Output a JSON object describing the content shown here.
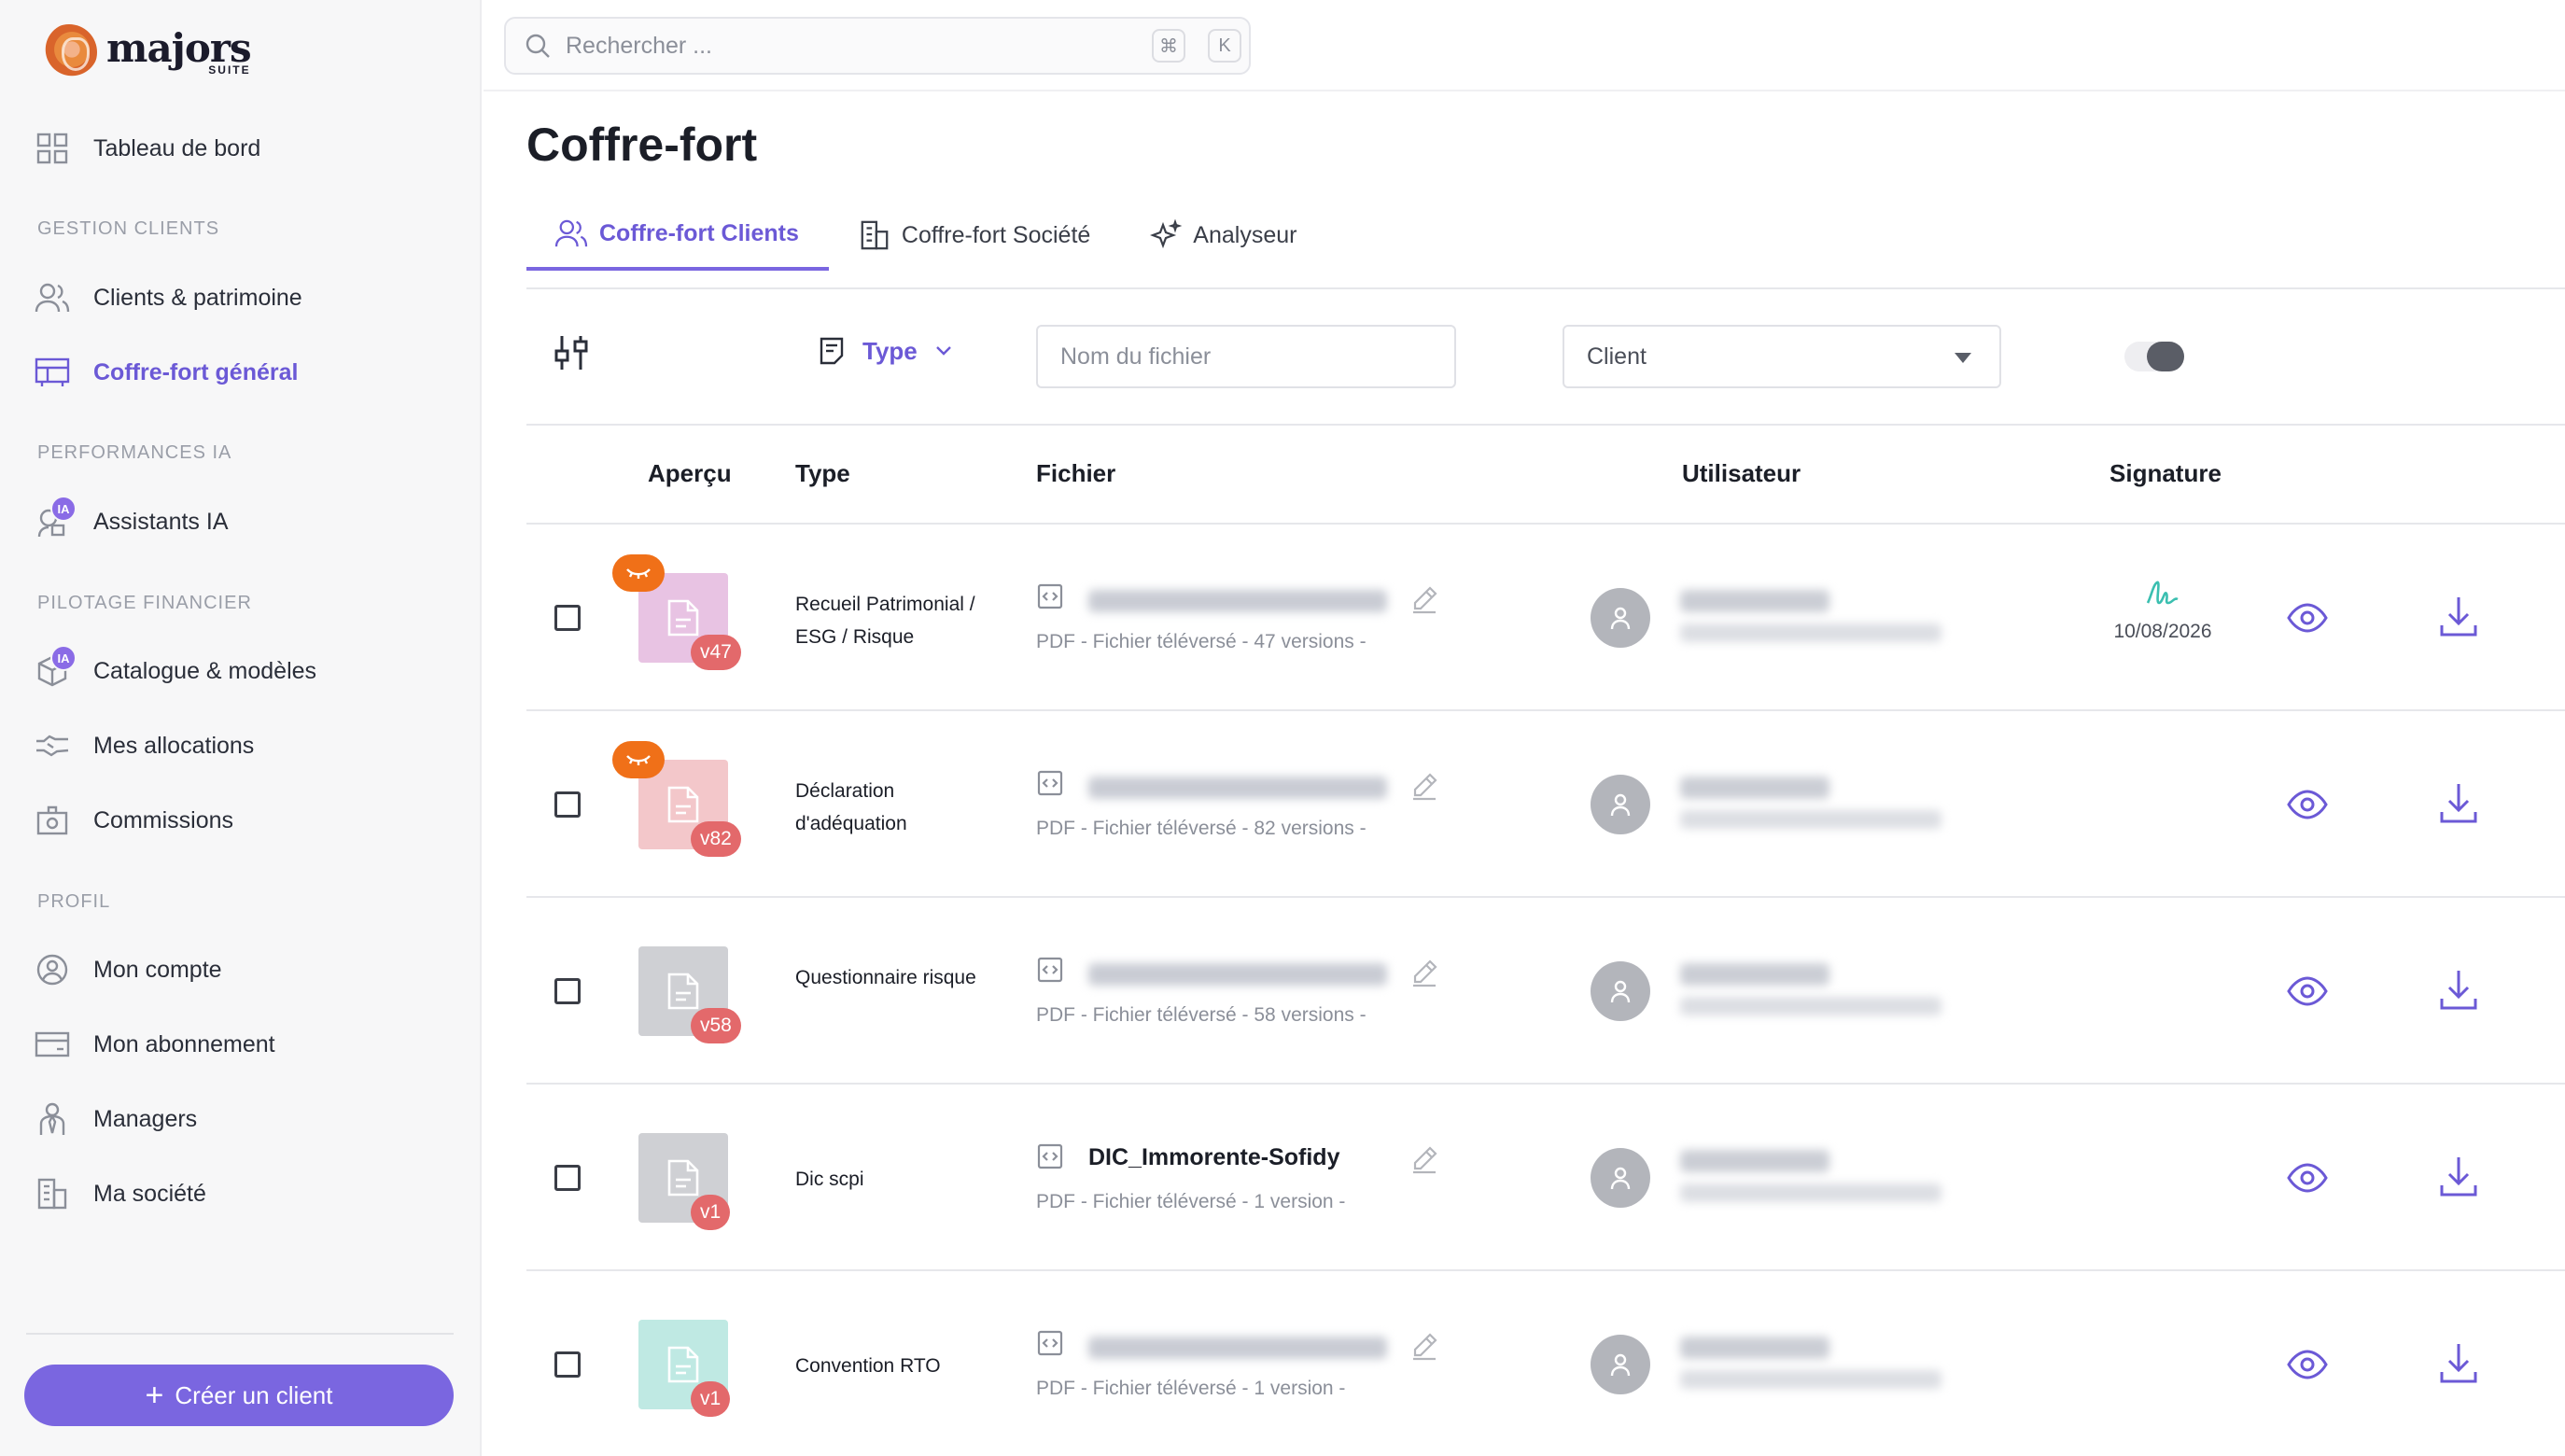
{
  "brand": {
    "name": "majors",
    "sub": "SUITE"
  },
  "sidebar": {
    "dashboard": "Tableau de bord",
    "sections": [
      {
        "label": "GESTION CLIENTS"
      },
      {
        "label": "PERFORMANCES IA"
      },
      {
        "label": "PILOTAGE FINANCIER"
      },
      {
        "label": "PROFIL"
      }
    ],
    "items": {
      "clients": "Clients & patrimoine",
      "coffre": "Coffre-fort général",
      "assistants": "Assistants IA",
      "catalogue": "Catalogue & modèles",
      "allocations": "Mes allocations",
      "commissions": "Commissions",
      "compte": "Mon compte",
      "abonnement": "Mon abonnement",
      "managers": "Managers",
      "societe": "Ma société"
    },
    "ia_badge": "IA",
    "create_button": "Créer un client"
  },
  "search": {
    "placeholder": "Rechercher ...",
    "kbd1": "⌘",
    "kbd2": "K"
  },
  "page": {
    "title": "Coffre-fort",
    "tabs": [
      "Coffre-fort Clients",
      "Coffre-fort Société",
      "Analyseur"
    ]
  },
  "filters": {
    "type_label": "Type",
    "file_placeholder": "Nom du fichier",
    "client_label": "Client",
    "toggle_on": true
  },
  "table": {
    "headers": [
      "Aperçu",
      "Type",
      "Fichier",
      "Utilisateur",
      "Signature"
    ],
    "rows": [
      {
        "type": "Recueil Patrimonial / ESG / Risque",
        "version": "v47",
        "file_name": "",
        "meta": "PDF - Fichier téléversé - 47 versions -",
        "signed": true,
        "sig_date": "10/08/2026",
        "thumb_color": "#e8c3e3",
        "eye_badge": true
      },
      {
        "type": "Déclaration d'adéquation",
        "version": "v82",
        "file_name": "",
        "meta": "PDF - Fichier téléversé - 82 versions -",
        "signed": false,
        "sig_date": "",
        "thumb_color": "#f3c7ca",
        "eye_badge": true
      },
      {
        "type": "Questionnaire risque",
        "version": "v58",
        "file_name": "",
        "meta": "PDF - Fichier téléversé - 58 versions -",
        "signed": false,
        "sig_date": "",
        "thumb_color": "#cfd0d4",
        "eye_badge": false
      },
      {
        "type": "Dic scpi",
        "version": "v1",
        "file_name": "DIC_Immorente-Sofidy",
        "meta": "PDF - Fichier téléversé - 1 version -",
        "signed": false,
        "sig_date": "",
        "thumb_color": "#cfd0d4",
        "eye_badge": false
      },
      {
        "type": "Convention RTO",
        "version": "v1",
        "file_name": "",
        "meta": "PDF - Fichier téléversé - 1 version -",
        "signed": false,
        "sig_date": "",
        "thumb_color": "#bfe9e3",
        "eye_badge": false
      }
    ]
  },
  "colors": {
    "accent": "#7a66e0",
    "badge_red": "#e3696b",
    "eye_orange": "#f07018",
    "signature_teal": "#3bbfb0"
  }
}
